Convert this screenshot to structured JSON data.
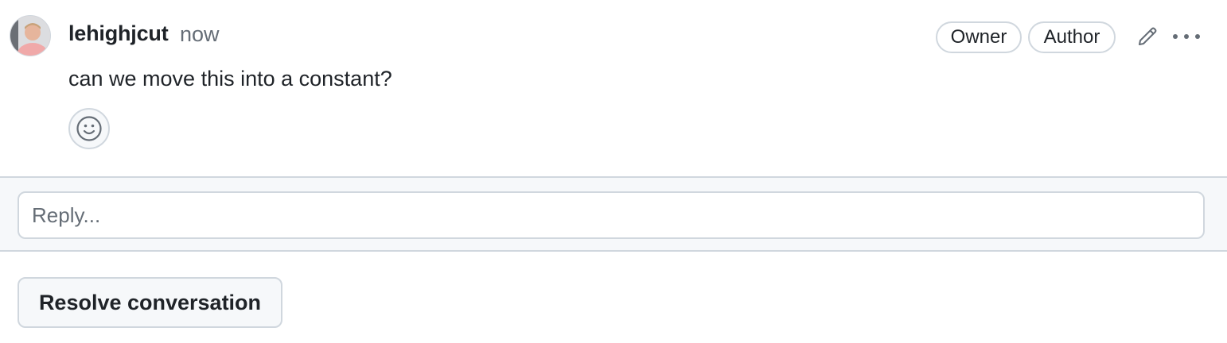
{
  "comment": {
    "author": "lehighjcut",
    "timestamp": "now",
    "badges": [
      "Owner",
      "Author"
    ],
    "body": "can we move this into a constant?",
    "avatar_icon": "user-avatar",
    "edit_icon": "pencil-icon",
    "more_icon": "kebab-horizontal-icon",
    "reaction_icon": "smiley-icon"
  },
  "reply": {
    "placeholder": "Reply..."
  },
  "actions": {
    "resolve_label": "Resolve conversation"
  },
  "colors": {
    "text": "#1f2328",
    "muted": "#656d76",
    "border": "#d0d7de",
    "subtle_bg": "#f6f8fa"
  }
}
